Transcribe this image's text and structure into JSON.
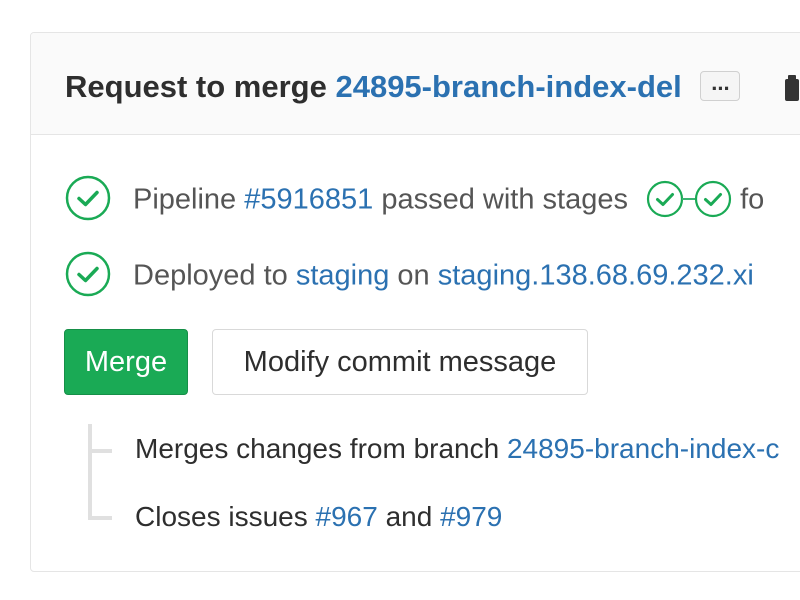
{
  "header": {
    "title_prefix": "Request to merge",
    "branch": "24895-branch-index-del",
    "ellipsis": "..."
  },
  "pipeline": {
    "prefix": "Pipeline",
    "id": "#5916851",
    "suffix": "passed with stages",
    "trailing": "fo"
  },
  "deploy": {
    "prefix": "Deployed to",
    "environment": "staging",
    "on": "on",
    "url": "staging.138.68.69.232.xi"
  },
  "actions": {
    "merge_label": "Merge",
    "modify_label": "Modify commit message"
  },
  "info": {
    "merges_prefix": "Merges changes from branch",
    "merges_branch": "24895-branch-index-c",
    "closes_prefix": "Closes issues",
    "issue_1": "#967",
    "and": "and",
    "issue_2": "#979"
  },
  "colors": {
    "success": "#1aaa55",
    "link": "#2b71b1"
  },
  "icons": {
    "status": "check-circle-icon",
    "stage": "check-circle-icon",
    "clipboard": "clipboard-icon"
  }
}
